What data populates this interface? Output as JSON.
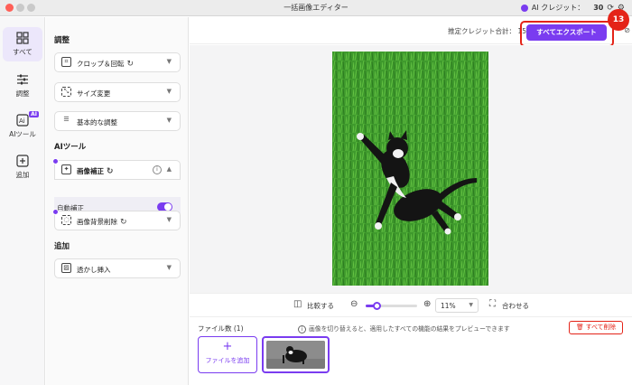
{
  "window": {
    "title": "一括画像エディター"
  },
  "titlebar": {
    "credit_label": "AI クレジット：",
    "credit_value": "30"
  },
  "nav": {
    "items": [
      {
        "label": "すべて",
        "icon": "grid-icon"
      },
      {
        "label": "調整",
        "icon": "sliders-icon"
      },
      {
        "label": "AIツール",
        "icon": "ai-icon",
        "badge": "AI"
      },
      {
        "label": "追加",
        "icon": "plus-square-icon"
      }
    ]
  },
  "panel": {
    "sections": {
      "adjust": "調整",
      "ai_tools": "AIツール",
      "add": "追加"
    },
    "tools": {
      "crop": "クロップ＆回転",
      "resize": "サイズ変更",
      "basic": "基本的な調整",
      "enhance": "画像補正",
      "auto_enhance": "自動補正",
      "bg_remove": "画像背景削除",
      "watermark": "透かし挿入"
    }
  },
  "topbar": {
    "estimate_label": "推定クレジット合計：",
    "estimate_value": "15",
    "export_label": "すべてエクスポート",
    "step_number": "13"
  },
  "zoombar": {
    "compare_label": "比較する",
    "zoom_value": "11%",
    "zoom_level_fraction": 0.11,
    "fit_label": "合わせる"
  },
  "filebar": {
    "file_count": "ファイル数 (1)",
    "hint": "画像を切り替えると、適用したすべての機能の結果をプレビューできます",
    "delete_all": "すべて削除",
    "add_file": "ファイルを追加"
  },
  "colors": {
    "accent": "#7a3cf0",
    "highlight": "#e42318",
    "grass": "#3e9b2c"
  }
}
